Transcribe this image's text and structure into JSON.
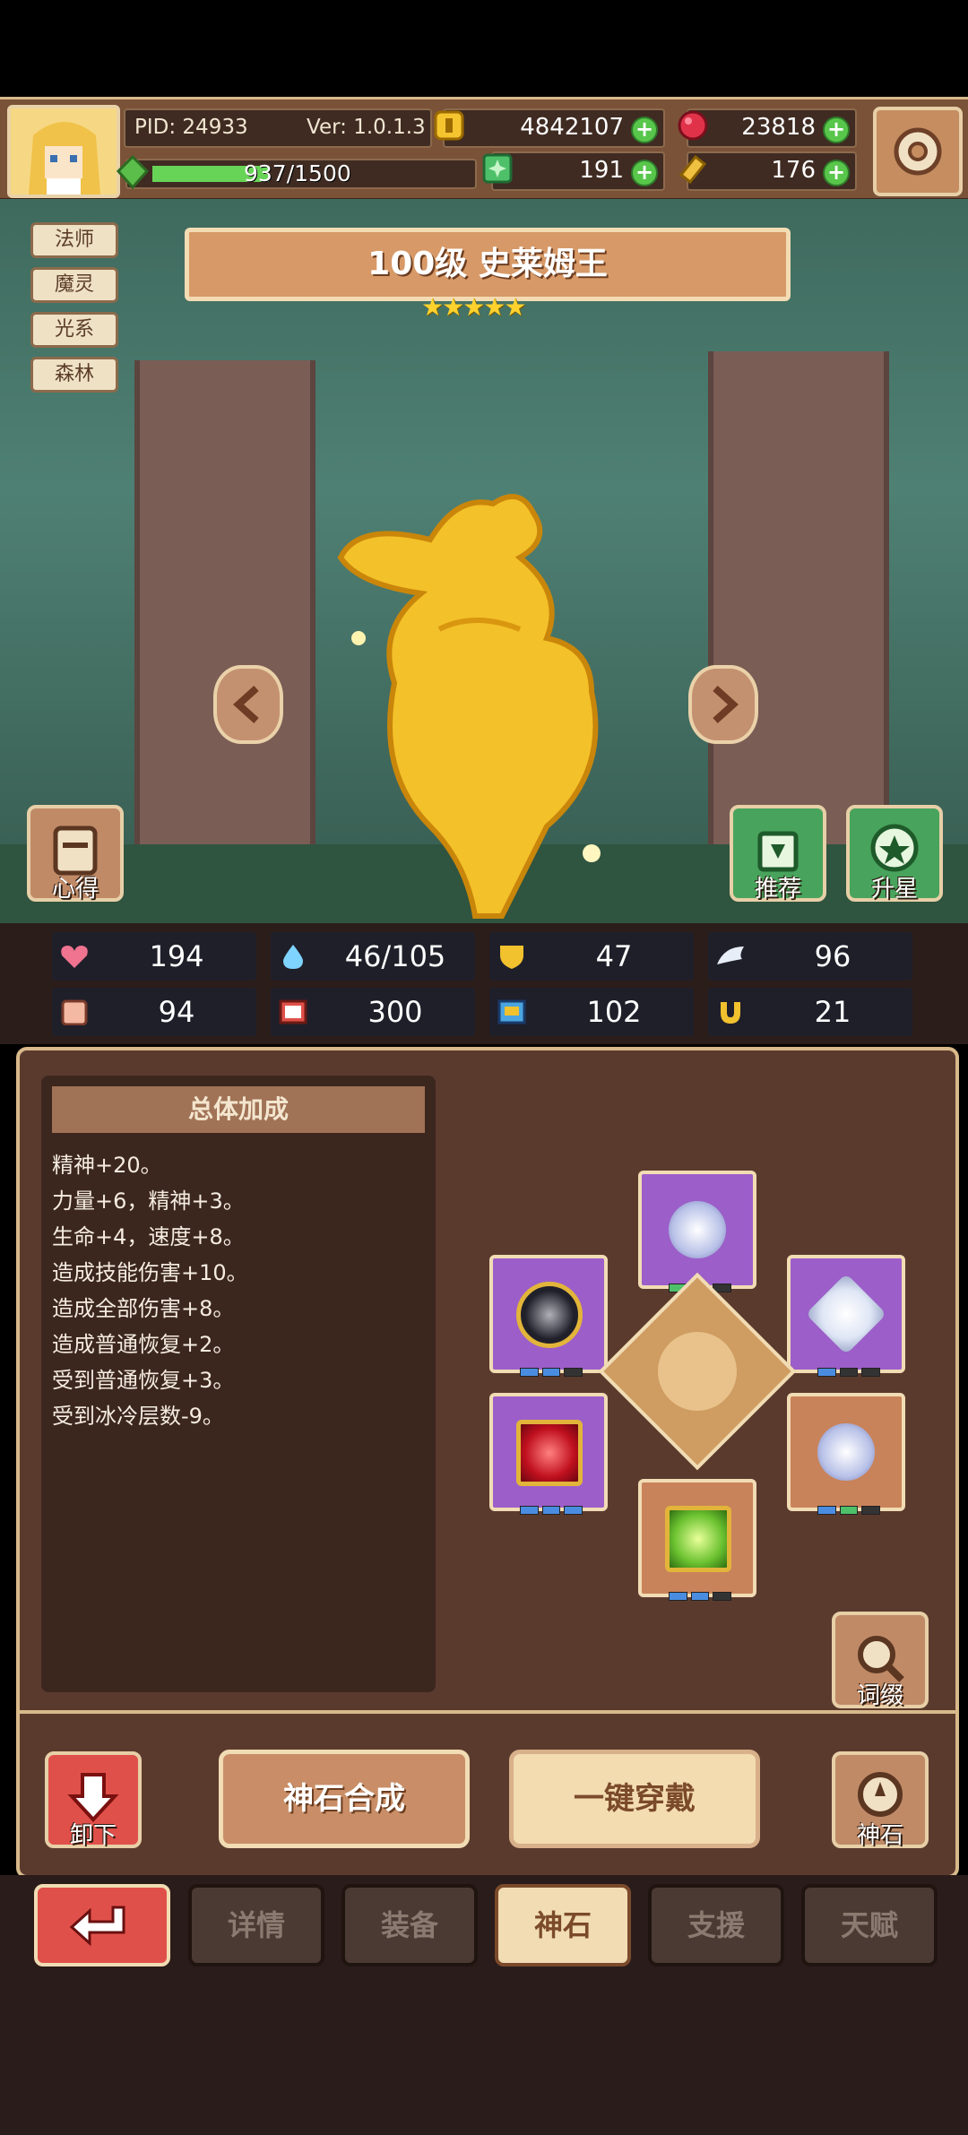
{
  "top": {
    "pid": "PID: 24933",
    "version": "Ver: 1.0.1.3",
    "gold": "4842107",
    "ruby": "23818",
    "xp": "937/1500",
    "clover": "191",
    "ticket": "176"
  },
  "scene": {
    "tags": [
      "法师",
      "魔灵",
      "光系",
      "森林"
    ],
    "title": "100级 史莱姆王",
    "stars": "★★★★★",
    "left_button": "心得",
    "recommend_button": "推荐",
    "upstar_button": "升星"
  },
  "stats": [
    {
      "icon": "heart-icon",
      "value": "194"
    },
    {
      "icon": "mana-drop-icon",
      "value": "46/105"
    },
    {
      "icon": "shield-icon",
      "value": "47"
    },
    {
      "icon": "wing-icon",
      "value": "96"
    },
    {
      "icon": "fist-icon",
      "value": "94"
    },
    {
      "icon": "book-icon",
      "value": "300"
    },
    {
      "icon": "boot-icon",
      "value": "102"
    },
    {
      "icon": "magnet-icon",
      "value": "21"
    }
  ],
  "bonus": {
    "title": "总体加成",
    "lines": [
      "精神+20。",
      "力量+6，精神+3。",
      "生命+4，速度+8。",
      "造成技能伤害+10。",
      "造成全部伤害+8。",
      "造成普通恢复+2。",
      "受到普通恢复+3。",
      "受到冰冷层数-9。"
    ]
  },
  "panel": {
    "affix_button": "词缀",
    "unload_button": "卸下",
    "synth_button": "神石合成",
    "equip_all_button": "一键穿戴",
    "godstone_button": "神石"
  },
  "tabs": {
    "back": "",
    "items": [
      "详情",
      "装备",
      "神石",
      "支援",
      "天赋"
    ],
    "active": "神石"
  },
  "colors": {
    "accent": "#e0504a",
    "panel": "#5b3a2e",
    "gold_frame": "#f1dcb4"
  }
}
